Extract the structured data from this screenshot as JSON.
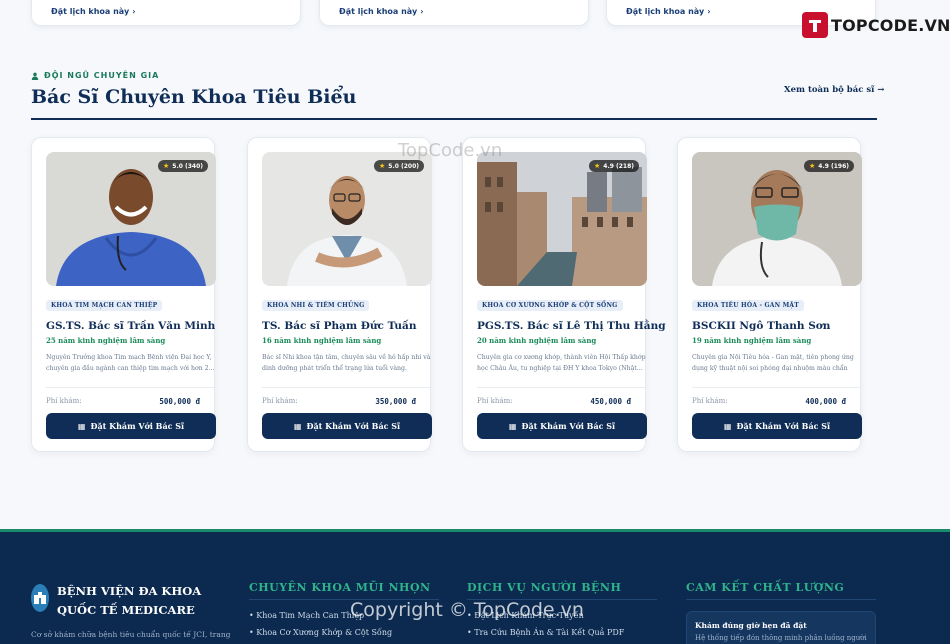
{
  "top_cards": [
    {
      "link": "Đặt lịch khoa này"
    },
    {
      "link": "Đặt lịch khoa này"
    },
    {
      "link": "Đặt lịch khoa này"
    }
  ],
  "watermark": {
    "logo_text": "TOPCODE.VN",
    "center": "TopCode.vn",
    "copyright": "Copyright © TopCode.vn"
  },
  "section": {
    "eyebrow": "ĐỘI NGŨ CHUYÊN GIA",
    "title": "Bác Sĩ Chuyên Khoa Tiêu Biểu",
    "view_all": "Xem toàn bộ bác sĩ"
  },
  "doctors": [
    {
      "rating": "5.0 (340)",
      "dept": "KHOA TIM MẠCH CAN THIỆP",
      "name": "GS.TS. Bác sĩ Trần Văn Minh",
      "exp": "25 năm kinh nghiệm lâm sàng",
      "desc": "Nguyên Trưởng khoa Tim mạch Bệnh viện Đại học Y, chuyên gia đầu ngành can thiệp tim mạch với hơn 2...",
      "fee_label": "Phí khám:",
      "fee": "500,000 đ",
      "button": "Đặt Khám Với Bác Sĩ"
    },
    {
      "rating": "5.0 (200)",
      "dept": "KHOA NHI & TIÊM CHỦNG",
      "name": "TS. Bác sĩ Phạm Đức Tuấn",
      "exp": "16 năm kinh nghiệm lâm sàng",
      "desc": "Bác sĩ Nhi khoa tận tâm, chuyên sâu về hô hấp nhi và dinh dưỡng phát triển thể trạng lứa tuổi vàng.",
      "fee_label": "Phí khám:",
      "fee": "350,000 đ",
      "button": "Đặt Khám Với Bác Sĩ"
    },
    {
      "rating": "4.9 (218)",
      "dept": "KHOA CƠ XƯƠNG KHỚP & CỘT SỐNG",
      "name": "PGS.TS. Bác sĩ Lê Thị Thu Hằng",
      "exp": "20 năm kinh nghiệm lâm sàng",
      "desc": "Chuyên gia cơ xương khớp, thành viên Hội Thấp khớp học Châu Âu, tu nghiệp tại ĐH Y khoa Tokyo (Nhật...",
      "fee_label": "Phí khám:",
      "fee": "450,000 đ",
      "button": "Đặt Khám Với Bác Sĩ"
    },
    {
      "rating": "4.9 (196)",
      "dept": "KHOA TIÊU HÓA - GAN MẬT",
      "name": "BSCKII Ngô Thanh Sơn",
      "exp": "19 năm kinh nghiệm lâm sàng",
      "desc": "Chuyên gia Nội Tiêu hóa - Gan mật, tiên phong ứng dụng kỹ thuật nội soi phóng đại nhuộm màu chẩn đo...",
      "fee_label": "Phí khám:",
      "fee": "400,000 đ",
      "button": "Đặt Khám Với Bác Sĩ"
    }
  ],
  "footer": {
    "brand_line1": "BỆNH VIỆN ĐA KHOA",
    "brand_line2": "QUỐC TẾ MEDICARE",
    "sub": "Cơ sở khám chữa bệnh tiêu chuẩn quốc tế JCI, trang",
    "col1_title": "CHUYÊN KHOA MŨI NHỌN",
    "col1_items": [
      "• Khoa Tim Mạch Can Thiệp",
      "• Khoa Cơ Xương Khớp & Cột Sống"
    ],
    "col2_title": "DỊCH VỤ NGƯỜI BỆNH",
    "col2_items": [
      "• Đặt Lịch Khám Trực Tuyến",
      "• Tra Cứu Bệnh Án & Tài Kết Quả PDF"
    ],
    "col3_title": "CAM KẾT CHẤT LƯỢNG",
    "commit_title": "Khám đúng giờ hẹn đã đặt",
    "commit_desc": "Hệ thống tiếp đón thông minh phân luồng người"
  }
}
